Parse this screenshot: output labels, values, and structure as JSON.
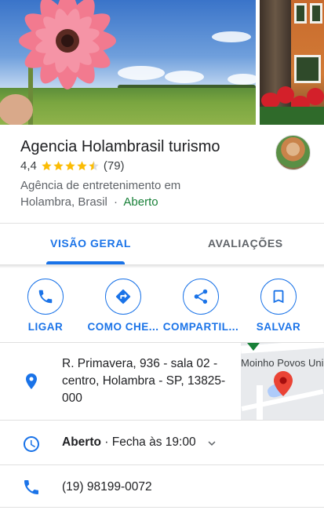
{
  "place": {
    "name": "Agencia Holambrasil turismo",
    "rating": "4,4",
    "rating_value": 4.4,
    "reviews_count": "(79)",
    "category_line": "Agência de entretenimento em Holambra, Brasil",
    "separator": "·",
    "open_status": "Aberto"
  },
  "tabs": [
    {
      "label": "VISÃO GERAL",
      "active": true
    },
    {
      "label": "AVALIAÇÕES",
      "active": false
    }
  ],
  "actions": [
    {
      "label": "LIGAR",
      "icon": "phone-icon"
    },
    {
      "label": "COMO CHE...",
      "icon": "directions-icon"
    },
    {
      "label": "COMPARTIL...",
      "icon": "share-icon"
    },
    {
      "label": "SALVAR",
      "icon": "bookmark-icon"
    }
  ],
  "address": {
    "text": "R. Primavera, 936 - sala 02 - centro, Holambra - SP, 13825-000",
    "icon": "location-pin-icon",
    "map_label": "Moinho Povos Uni"
  },
  "hours": {
    "status": "Aberto",
    "detail": " · Fecha às 19:00",
    "icon": "clock-icon"
  },
  "phone": {
    "number": "(19) 98199-0072",
    "icon": "phone-icon"
  },
  "colors": {
    "accent": "#1a73e8",
    "open_green": "#188038",
    "star": "#fbbc04",
    "text_secondary": "#5f6368"
  }
}
